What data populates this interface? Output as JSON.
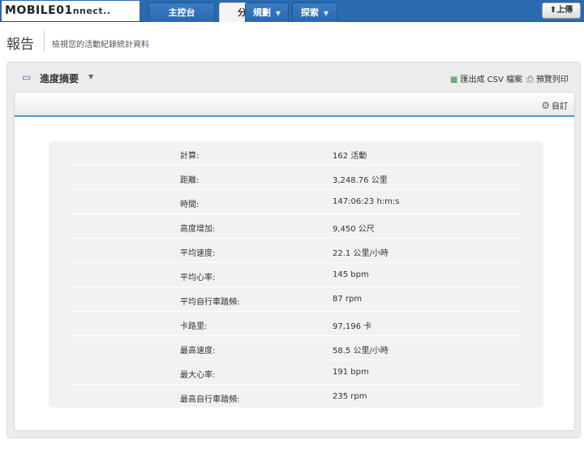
{
  "nav": {
    "logo_main": "MOBILE01",
    "logo_suffix": "nnect..",
    "tabs": [
      {
        "label": "主控台"
      },
      {
        "label": "分析"
      },
      {
        "label": "規劃"
      },
      {
        "label": "探索"
      }
    ],
    "upload_label": "上傳"
  },
  "header": {
    "title": "報告",
    "subtitle": "檢視您的活動紀錄統計資料"
  },
  "panel": {
    "title": "進度摘要",
    "export_label": "匯出成 CSV 檔案",
    "print_label": "預覽列印",
    "customize_label": "自訂"
  },
  "stats": [
    {
      "label": "計算:",
      "value": "162 活動"
    },
    {
      "label": "距離:",
      "value": "3,248.76 公里"
    },
    {
      "label": "時間:",
      "value": "147:06:23 h:m:s"
    },
    {
      "label": "高度增加:",
      "value": "9,450 公尺"
    },
    {
      "label": "平均速度:",
      "value": "22.1 公里/小時"
    },
    {
      "label": "平均心率:",
      "value": "145 bpm"
    },
    {
      "label": "平均自行車踏頻:",
      "value": "87 rpm"
    },
    {
      "label": "卡路里:",
      "value": "97,196 卡"
    },
    {
      "label": "最高速度:",
      "value": "58.5 公里/小時"
    },
    {
      "label": "最大心率:",
      "value": "191 bpm"
    },
    {
      "label": "最高自行車踏頻:",
      "value": "235 rpm"
    }
  ]
}
